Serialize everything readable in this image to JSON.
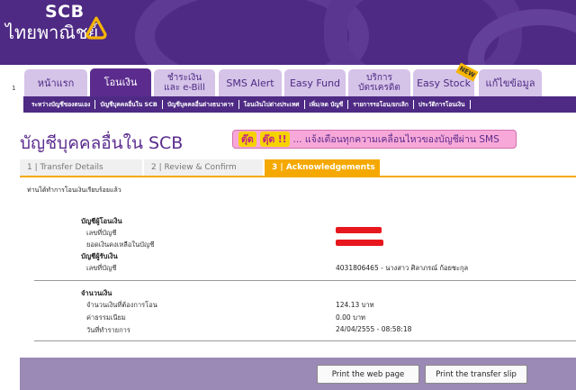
{
  "brand": {
    "name": "SCB",
    "thai_name": "ไทยพาณิชย์"
  },
  "tabs": {
    "page_number": "1",
    "items": [
      {
        "label": "หน้าแรก",
        "active": false
      },
      {
        "label": "โอนเงิน",
        "active": true
      },
      {
        "label_line1": "ชำระเงิน",
        "label_line2": "และ e-Bill",
        "active": false
      },
      {
        "label": "SMS Alert",
        "active": false
      },
      {
        "label": "Easy Fund",
        "active": false
      },
      {
        "label_line1": "บริการ",
        "label_line2": "บัตรเครดิต",
        "active": false
      },
      {
        "label": "Easy Stock",
        "badge": "NEW",
        "active": false
      },
      {
        "label": "แก้ไขข้อมูล",
        "active": false
      }
    ]
  },
  "subnav": [
    "ระหว่างบัญชีของตนเอง",
    "บัญชีบุคคลอื่นใน SCB",
    "บัญชีบุคคลอื่นต่างธนาคาร",
    "โอนเงินไปต่างประเทศ",
    "เพิ่ม/ลด บัญชี",
    "รายการรอโอน/ยกเลิก",
    "ประวัติการโอนเงิน"
  ],
  "page": {
    "title": "บัญชีบุคคลอื่นใน SCB",
    "promo_badge1": "ตุ๊ด",
    "promo_badge2": "ตุ๊ด !!",
    "promo_text": "... แจ้งเตือนทุกความเคลื่อนไหวของบัญชีผ่าน SMS"
  },
  "steps": [
    {
      "label": "1 | Transfer Details",
      "active": false
    },
    {
      "label": "2 | Review & Confirm",
      "active": false
    },
    {
      "label": "3 | Acknowledgements",
      "active": true
    }
  ],
  "success_message": "ท่านได้ทำการโอนเงินเรียบร้อยแล้ว",
  "from_account": {
    "heading": "บัญชีผู้โอนเงิน",
    "account_no_label": "เลขที่บัญชี",
    "balance_label": "ยอดเงินคงเหลือในบัญชี"
  },
  "to_account": {
    "heading": "บัญชีผู้รับเงิน",
    "account_no_label": "เลขที่บัญชี",
    "account_no_value": "4031806465 - นางสาว ศิลาภรณ์ ก้อยชะกุล"
  },
  "amount": {
    "heading": "จำนวนเงิน",
    "transfer_label": "จำนวนเงินที่ต้องการโอน",
    "transfer_value": "124.13 บาท",
    "fee_label": "ค่าธรรมเนียม",
    "fee_value": "0.00 บาท",
    "date_label": "วันที่ทำรายการ",
    "date_value": "24/04/2555 - 08:58:18"
  },
  "buttons": {
    "print_page": "Print the web page",
    "print_slip": "Print the transfer slip"
  },
  "colors": {
    "brand_purple": "#4e2a84",
    "tab_inactive": "#d5c3e8",
    "step_active": "#f5a800",
    "redaction": "#e8171e",
    "footer": "#9b89b6"
  }
}
